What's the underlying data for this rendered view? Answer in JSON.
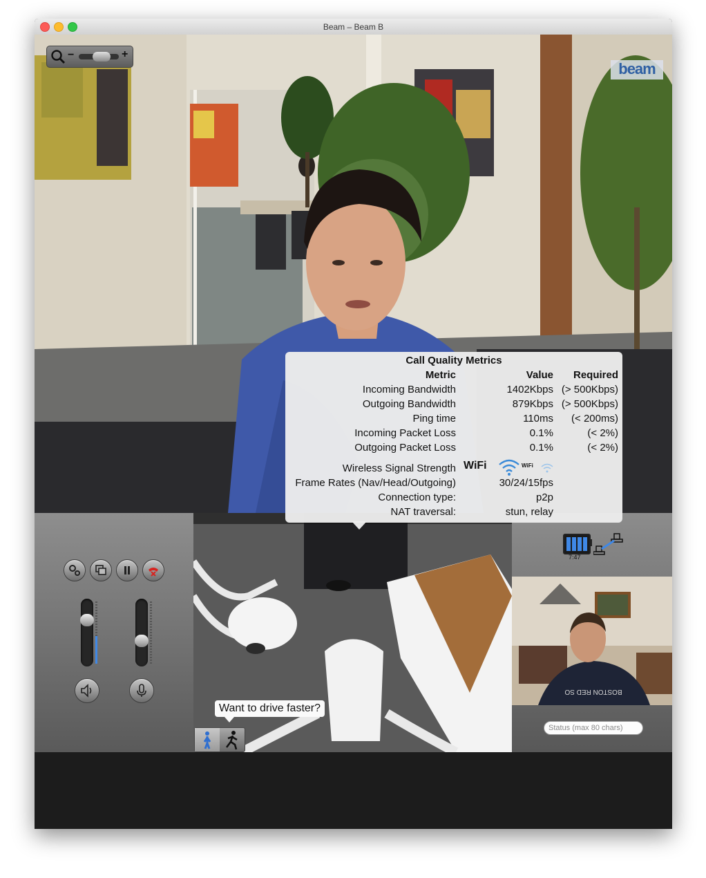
{
  "window": {
    "title": "Beam – Beam B"
  },
  "logo": {
    "text": "beam"
  },
  "zoom": {
    "minus": "−",
    "plus": "+",
    "level": 0.4
  },
  "metrics": {
    "title": "Call Quality Metrics",
    "headers": {
      "metric": "Metric",
      "value": "Value",
      "required": "Required"
    },
    "rows": [
      {
        "metric": "Incoming Bandwidth",
        "value": "1402Kbps",
        "required": "(> 500Kbps)"
      },
      {
        "metric": "Outgoing Bandwidth",
        "value": "879Kbps",
        "required": "(> 500Kbps)"
      },
      {
        "metric": "Ping time",
        "value": "110ms",
        "required": "(< 200ms)"
      },
      {
        "metric": "Incoming Packet Loss",
        "value": "0.1%",
        "required": "(< 2%)"
      },
      {
        "metric": "Outgoing Packet Loss",
        "value": "0.1%",
        "required": "(< 2%)"
      }
    ],
    "wifi": {
      "label": "Wireless Signal Strength",
      "text1": "WiFi",
      "text2": "WiFi"
    },
    "extra": [
      {
        "metric": "Frame Rates (Nav/Head/Outgoing)",
        "value": "30/24/15fps"
      },
      {
        "metric": "Connection type:",
        "value": "p2p"
      },
      {
        "metric": "NAT traversal:",
        "value": "stun, relay"
      }
    ]
  },
  "controls": {
    "buttons": [
      "settings-icon",
      "windows-icon",
      "pause-icon",
      "hangup-icon"
    ],
    "speaker_volume": 0.7,
    "mic_volume": 0.4
  },
  "nav": {
    "drive_tip": "Want to drive faster?",
    "speed_selected": "walk"
  },
  "battery": {
    "time": "7:47",
    "level": 1.0
  },
  "status": {
    "placeholder": "Status (max 80 chars)"
  },
  "colors": {
    "accent": "#3f88e6",
    "hangup": "#d8231f",
    "tooltip_bg": "#ececec"
  }
}
